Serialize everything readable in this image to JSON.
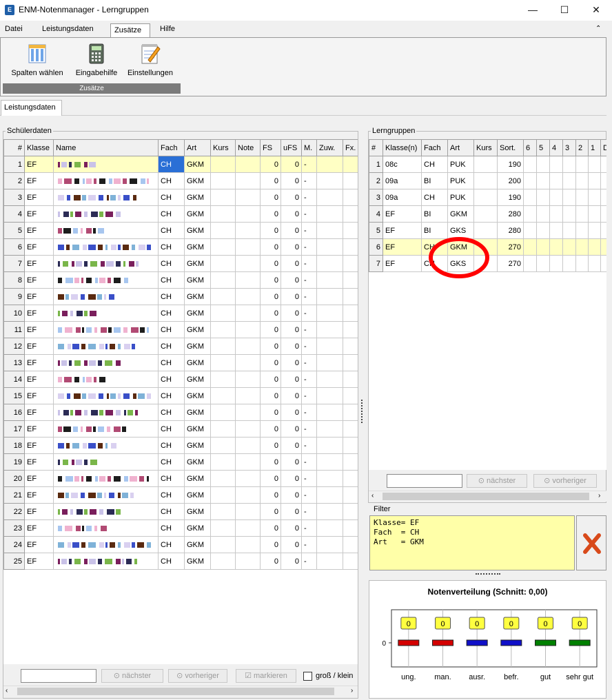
{
  "window": {
    "title": "ENM-Notenmanager - Lerngruppen",
    "icon_letter": "E",
    "minimize": "—",
    "maximize": "☐",
    "close": "✕"
  },
  "menu": {
    "tabs": [
      "Datei",
      "Leistungsdaten",
      "Zusätze",
      "Hilfe"
    ],
    "collapse": "⌃"
  },
  "ribbon": {
    "buttons": [
      {
        "label": "Spalten wählen",
        "icon": "columns-icon"
      },
      {
        "label": "Eingabehilfe",
        "icon": "calculator-icon"
      },
      {
        "label": "Einstellungen",
        "icon": "notepad-pencil-icon"
      }
    ],
    "group_label": "Zusätze"
  },
  "doc_tab": "Leistungsdaten",
  "schueler": {
    "title": "Schülerdaten",
    "columns": [
      "#",
      "Klasse",
      "Name",
      "Fach",
      "Art",
      "Kurs",
      "Note",
      "FS",
      "uFS",
      "M.",
      "Zuw.",
      "Fx."
    ],
    "rows": [
      {
        "n": "1",
        "klasse": "EF",
        "fach": "CH",
        "art": "GKM",
        "fs": "0",
        "ufs": "0",
        "m": "-"
      },
      {
        "n": "2",
        "klasse": "EF",
        "fach": "CH",
        "art": "GKM",
        "fs": "0",
        "ufs": "0",
        "m": "-"
      },
      {
        "n": "3",
        "klasse": "EF",
        "fach": "CH",
        "art": "GKM",
        "fs": "0",
        "ufs": "0",
        "m": "-"
      },
      {
        "n": "4",
        "klasse": "EF",
        "fach": "CH",
        "art": "GKM",
        "fs": "0",
        "ufs": "0",
        "m": "-"
      },
      {
        "n": "5",
        "klasse": "EF",
        "fach": "CH",
        "art": "GKM",
        "fs": "0",
        "ufs": "0",
        "m": "-"
      },
      {
        "n": "6",
        "klasse": "EF",
        "fach": "CH",
        "art": "GKM",
        "fs": "0",
        "ufs": "0",
        "m": "-"
      },
      {
        "n": "7",
        "klasse": "EF",
        "fach": "CH",
        "art": "GKM",
        "fs": "0",
        "ufs": "0",
        "m": "-"
      },
      {
        "n": "8",
        "klasse": "EF",
        "fach": "CH",
        "art": "GKM",
        "fs": "0",
        "ufs": "0",
        "m": "-"
      },
      {
        "n": "9",
        "klasse": "EF",
        "fach": "CH",
        "art": "GKM",
        "fs": "0",
        "ufs": "0",
        "m": "-"
      },
      {
        "n": "10",
        "klasse": "EF",
        "fach": "CH",
        "art": "GKM",
        "fs": "0",
        "ufs": "0",
        "m": "-"
      },
      {
        "n": "11",
        "klasse": "EF",
        "fach": "CH",
        "art": "GKM",
        "fs": "0",
        "ufs": "0",
        "m": "-"
      },
      {
        "n": "12",
        "klasse": "EF",
        "fach": "CH",
        "art": "GKM",
        "fs": "0",
        "ufs": "0",
        "m": "-"
      },
      {
        "n": "13",
        "klasse": "EF",
        "fach": "CH",
        "art": "GKM",
        "fs": "0",
        "ufs": "0",
        "m": "-"
      },
      {
        "n": "14",
        "klasse": "EF",
        "fach": "CH",
        "art": "GKM",
        "fs": "0",
        "ufs": "0",
        "m": "-"
      },
      {
        "n": "15",
        "klasse": "EF",
        "fach": "CH",
        "art": "GKM",
        "fs": "0",
        "ufs": "0",
        "m": "-"
      },
      {
        "n": "16",
        "klasse": "EF",
        "fach": "CH",
        "art": "GKM",
        "fs": "0",
        "ufs": "0",
        "m": "-"
      },
      {
        "n": "17",
        "klasse": "EF",
        "fach": "CH",
        "art": "GKM",
        "fs": "0",
        "ufs": "0",
        "m": "-"
      },
      {
        "n": "18",
        "klasse": "EF",
        "fach": "CH",
        "art": "GKM",
        "fs": "0",
        "ufs": "0",
        "m": "-"
      },
      {
        "n": "19",
        "klasse": "EF",
        "fach": "CH",
        "art": "GKM",
        "fs": "0",
        "ufs": "0",
        "m": "-"
      },
      {
        "n": "20",
        "klasse": "EF",
        "fach": "CH",
        "art": "GKM",
        "fs": "0",
        "ufs": "0",
        "m": "-"
      },
      {
        "n": "21",
        "klasse": "EF",
        "fach": "CH",
        "art": "GKM",
        "fs": "0",
        "ufs": "0",
        "m": "-"
      },
      {
        "n": "22",
        "klasse": "EF",
        "fach": "CH",
        "art": "GKM",
        "fs": "0",
        "ufs": "0",
        "m": "-"
      },
      {
        "n": "23",
        "klasse": "EF",
        "fach": "CH",
        "art": "GKM",
        "fs": "0",
        "ufs": "0",
        "m": "-"
      },
      {
        "n": "24",
        "klasse": "EF",
        "fach": "CH",
        "art": "GKM",
        "fs": "0",
        "ufs": "0",
        "m": "-"
      },
      {
        "n": "25",
        "klasse": "EF",
        "fach": "CH",
        "art": "GKM",
        "fs": "0",
        "ufs": "0",
        "m": "-"
      }
    ],
    "toolbar": {
      "next": "nächster",
      "prev": "vorheriger",
      "mark": "markieren",
      "case": "groß / klein"
    }
  },
  "lerngruppen": {
    "title": "Lerngruppen",
    "columns": [
      "#",
      "Klasse(n)",
      "Fach",
      "Art",
      "Kurs",
      "Sort.",
      "6",
      "5",
      "4",
      "3",
      "2",
      "1",
      "D"
    ],
    "rows": [
      {
        "n": "1",
        "klasse": "08c",
        "fach": "CH",
        "art": "PUK",
        "sort": "190"
      },
      {
        "n": "2",
        "klasse": "09a",
        "fach": "BI",
        "art": "PUK",
        "sort": "200"
      },
      {
        "n": "3",
        "klasse": "09a",
        "fach": "CH",
        "art": "PUK",
        "sort": "190"
      },
      {
        "n": "4",
        "klasse": "EF",
        "fach": "BI",
        "art": "GKM",
        "sort": "280"
      },
      {
        "n": "5",
        "klasse": "EF",
        "fach": "BI",
        "art": "GKS",
        "sort": "280"
      },
      {
        "n": "6",
        "klasse": "EF",
        "fach": "CH",
        "art": "GKM",
        "sort": "270"
      },
      {
        "n": "7",
        "klasse": "EF",
        "fach": "CH",
        "art": "GKS",
        "sort": "270"
      }
    ],
    "toolbar": {
      "next": "nächster",
      "prev": "vorheriger"
    }
  },
  "filter": {
    "title": "Filter",
    "text": "Klasse= EF\nFach  = CH\nArt   = GKM"
  },
  "chart_data": {
    "type": "bar",
    "title": "Notenverteilung (Schnitt: 0,00)",
    "categories": [
      "ung.",
      "man.",
      "ausr.",
      "befr.",
      "gut",
      "sehr gut"
    ],
    "values": [
      0,
      0,
      0,
      0,
      0,
      0
    ],
    "colors": [
      "#d40000",
      "#d40000",
      "#1010c8",
      "#1010c8",
      "#008000",
      "#008000"
    ],
    "ytick": "0",
    "value_badge_color": "#ffff40"
  },
  "colors": {
    "highlight_row": "#ffffc4",
    "selection": "#2a6fd6",
    "annotation_circle": "#ff0000"
  }
}
